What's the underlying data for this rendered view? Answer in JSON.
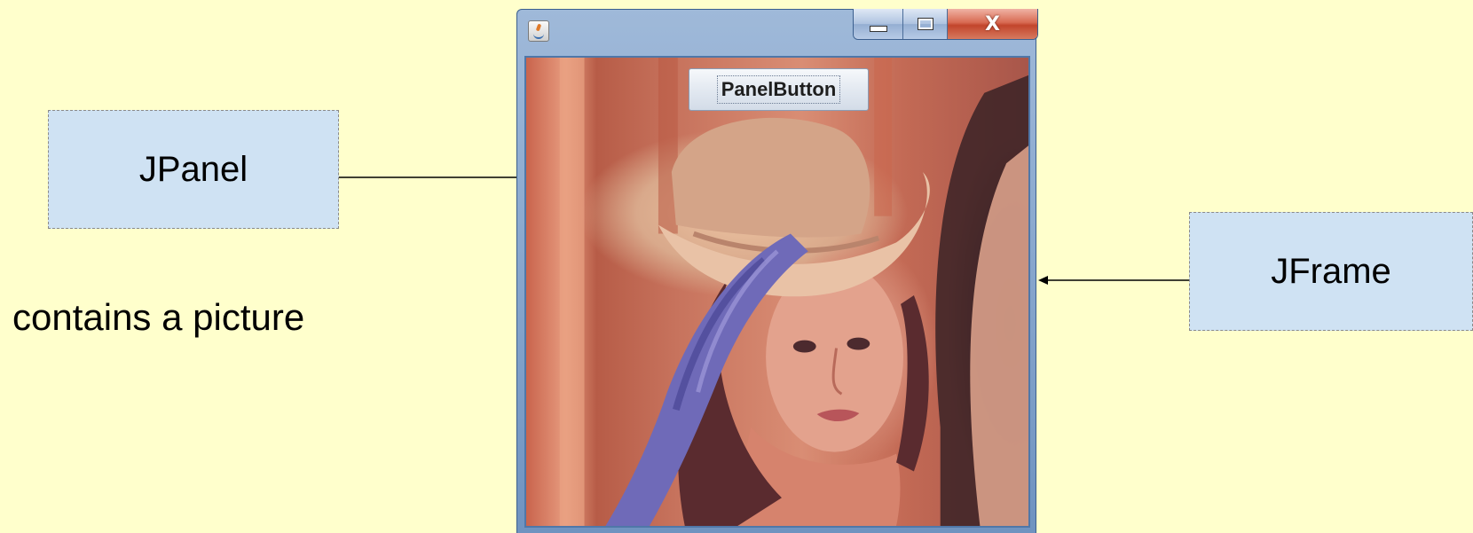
{
  "callouts": {
    "jpanel": "JPanel",
    "jframe": "JFrame"
  },
  "caption": "contains a picture",
  "window": {
    "controls": {
      "minimize_icon": "minimize-icon",
      "maximize_icon": "maximize-icon",
      "close_glyph": "X"
    },
    "panel_button_label": "PanelButton"
  },
  "colors": {
    "background": "#ffffcc",
    "callout_fill": "#cfe2f3",
    "close_button": "#c2452c"
  }
}
